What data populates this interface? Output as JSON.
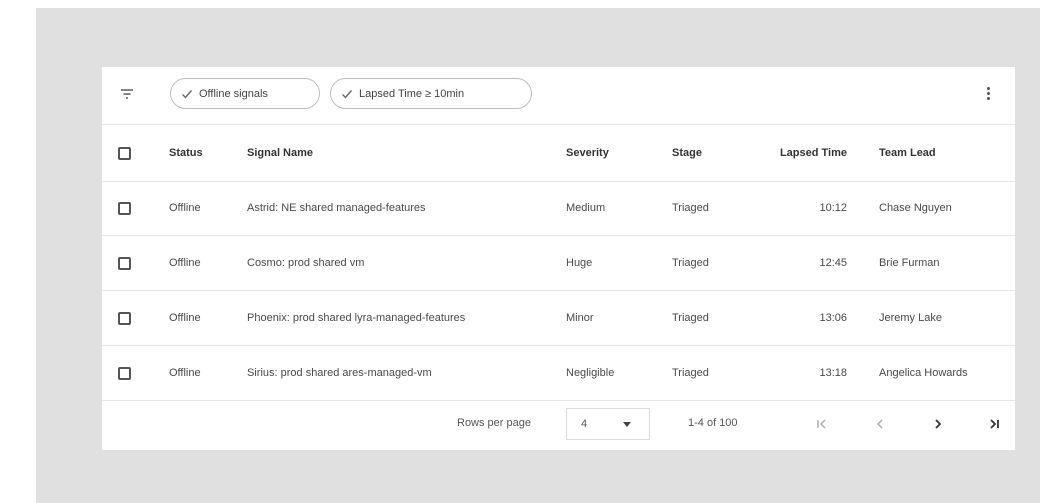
{
  "toolbar": {
    "chips": [
      {
        "label": "Offline signals"
      },
      {
        "label": "Lapsed Time ≥ 10min"
      }
    ]
  },
  "table": {
    "columns": [
      "Status",
      "Signal Name",
      "Severity",
      "Stage",
      "Lapsed Time",
      "Team Lead"
    ],
    "rows": [
      {
        "status": "Offline",
        "name": "Astrid: NE shared managed-features",
        "severity": "Medium",
        "stage": "Triaged",
        "time": "10:12",
        "lead": "Chase Nguyen"
      },
      {
        "status": "Offline",
        "name": "Cosmo: prod shared vm",
        "severity": "Huge",
        "stage": "Triaged",
        "time": "12:45",
        "lead": "Brie Furman"
      },
      {
        "status": "Offline",
        "name": "Phoenix: prod shared lyra-managed-features",
        "severity": "Minor",
        "stage": "Triaged",
        "time": "13:06",
        "lead": "Jeremy Lake"
      },
      {
        "status": "Offline",
        "name": "Sirius: prod shared ares-managed-vm",
        "severity": "Negligible",
        "stage": "Triaged",
        "time": "13:18",
        "lead": "Angelica Howards"
      }
    ]
  },
  "pagination": {
    "rows_per_page_label": "Rows per page",
    "rows_per_page_value": "4",
    "range": "1-4 of 100"
  },
  "icons": {
    "filter": "filter-icon",
    "check": "check-icon",
    "more": "more-vert-icon",
    "first": "first-page-icon",
    "prev": "chevron-left-icon",
    "next": "chevron-right-icon",
    "last": "last-page-icon"
  },
  "colors": {
    "backdrop": "#e0e0e0",
    "card": "#ffffff",
    "divider": "#e6e6e6"
  }
}
